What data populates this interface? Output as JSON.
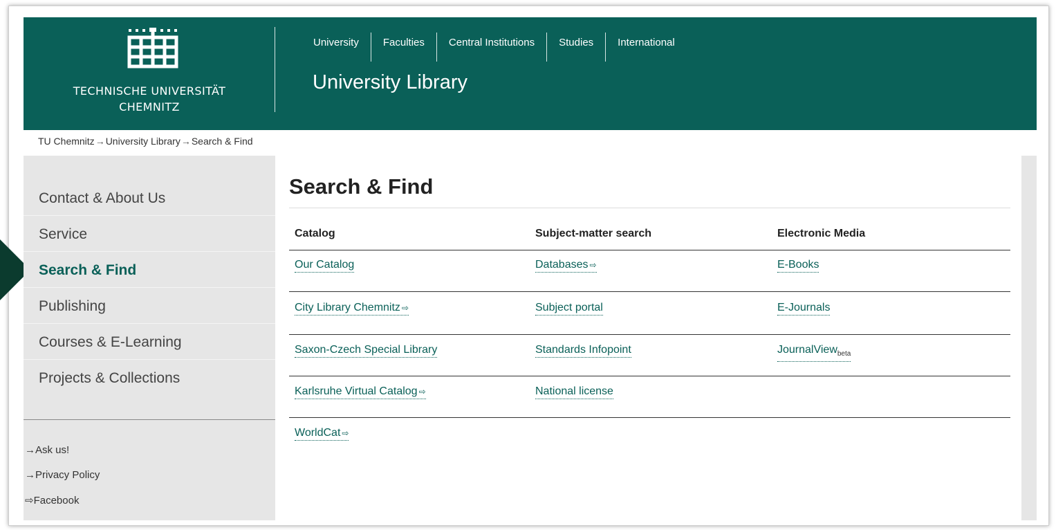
{
  "header": {
    "university_name_line1": "TECHNISCHE UNIVERSITÄT",
    "university_name_line2": "CHEMNITZ",
    "nav": [
      "University",
      "Faculties",
      "Central Institutions",
      "Studies",
      "International"
    ],
    "site_title": "University Library",
    "background_color": "#0a6058"
  },
  "breadcrumb": {
    "items": [
      "TU Chemnitz",
      "University Library",
      "Search & Find"
    ],
    "separator": "→"
  },
  "sidebar": {
    "items": [
      {
        "label": "Contact & About Us",
        "active": false
      },
      {
        "label": "Service",
        "active": false
      },
      {
        "label": "Search & Find",
        "active": true
      },
      {
        "label": "Publishing",
        "active": false
      },
      {
        "label": "Courses & E-Learning",
        "active": false
      },
      {
        "label": "Projects & Collections",
        "active": false
      }
    ],
    "links": [
      {
        "icon": "arrow-right-icon",
        "glyph": "→",
        "label": "Ask us!"
      },
      {
        "icon": "arrow-right-icon",
        "glyph": "→",
        "label": "Privacy Policy"
      },
      {
        "icon": "external-link-icon",
        "glyph": "⇨",
        "label": "Facebook"
      }
    ]
  },
  "main": {
    "title": "Search & Find",
    "columns": [
      "Catalog",
      "Subject-matter search",
      "Electronic Media"
    ],
    "rows": [
      [
        {
          "text": "Our Catalog",
          "external": false
        },
        {
          "text": "Databases",
          "external": true
        },
        {
          "text": "E-Books",
          "external": false
        }
      ],
      [
        {
          "text": "City Library Chemnitz",
          "external": true
        },
        {
          "text": "Subject portal",
          "external": false
        },
        {
          "text": "E-Journals",
          "external": false
        }
      ],
      [
        {
          "text": "Saxon-Czech Special Library",
          "external": false
        },
        {
          "text": "Standards Infopoint",
          "external": false
        },
        {
          "text": "JournalView",
          "external": false,
          "suffix": "beta"
        }
      ],
      [
        {
          "text": "Karlsruhe Virtual Catalog",
          "external": true
        },
        {
          "text": "National license",
          "external": false
        },
        null
      ],
      [
        {
          "text": "WorldCat",
          "external": true
        },
        null,
        null
      ]
    ],
    "external_glyph": "⇨",
    "link_color": "#0a6058"
  }
}
